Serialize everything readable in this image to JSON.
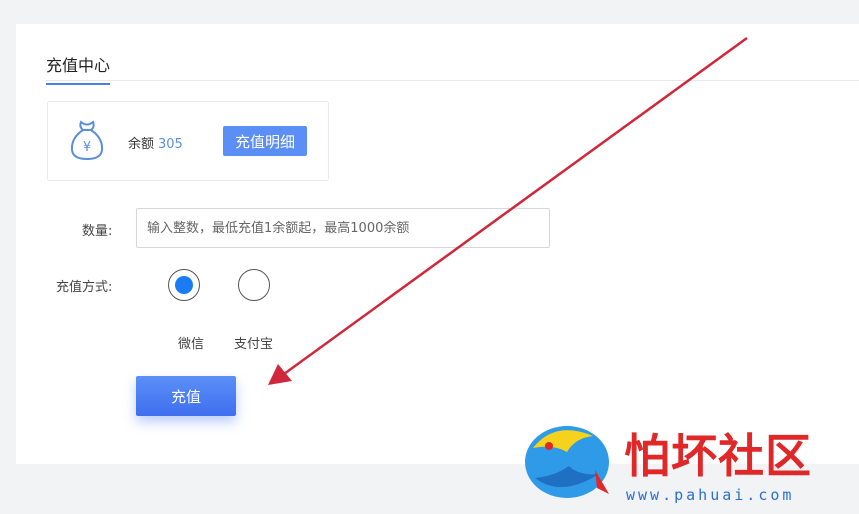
{
  "page": {
    "tab_title": "充值中心"
  },
  "balance": {
    "label": "余额",
    "value": "305",
    "detail_button": "充值明细",
    "icon": "money-bag-yuan-icon"
  },
  "form": {
    "quantity_label": "数量:",
    "quantity_value": "",
    "quantity_placeholder": "输入整数，最低充值1余额起，最高1000余额",
    "method_label": "充值方式:",
    "methods": [
      {
        "label": "微信",
        "selected": true
      },
      {
        "label": "支付宝",
        "selected": false
      }
    ],
    "submit_label": "充值"
  },
  "watermark": {
    "title": "怕坏社区",
    "url": "www.pahuai.com"
  },
  "colors": {
    "accent": "#4a7fe8",
    "radio_selected": "#1a7cf5",
    "balance_value": "#5b8fde",
    "arrow": "#d0283a",
    "watermark_red": "#e02828"
  }
}
